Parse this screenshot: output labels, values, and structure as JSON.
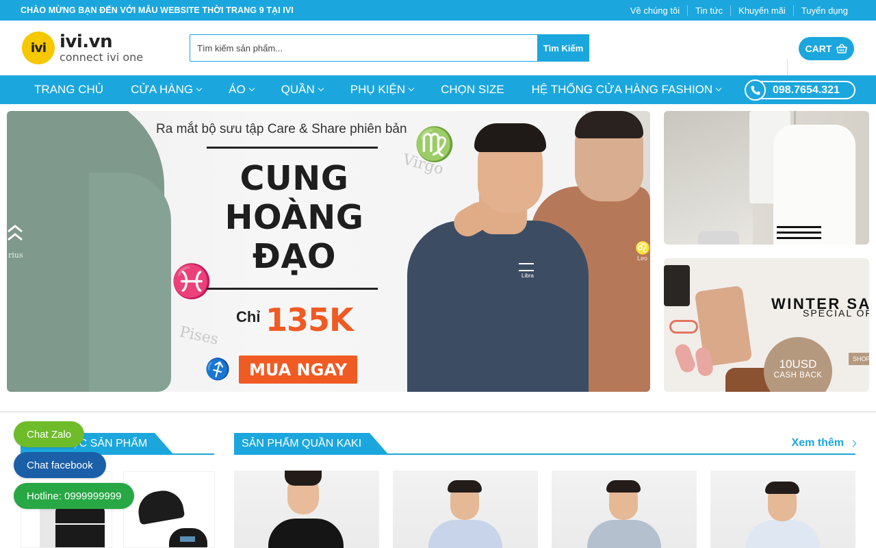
{
  "topbar": {
    "welcome": "CHÀO MỪNG BẠN ĐẾN VỚI MẪU WEBSITE THỜI TRANG 9 TẠI IVI",
    "links": [
      "Về chúng tôi",
      "Tin tức",
      "Khuyến mãi",
      "Tuyển dụng"
    ]
  },
  "header": {
    "logo_mark": "ivi",
    "logo_main": "ivi.vn",
    "logo_sub": "connect ivi one",
    "search_placeholder": "Tìm kiếm sản phẩm...",
    "search_button": "Tìm Kiếm",
    "cart_label": "CART"
  },
  "nav": {
    "items": [
      {
        "label": "TRANG CHỦ",
        "dropdown": false
      },
      {
        "label": "CỬA HÀNG",
        "dropdown": true
      },
      {
        "label": "ÁO",
        "dropdown": true
      },
      {
        "label": "QUẦN",
        "dropdown": true
      },
      {
        "label": "PHỤ KIỆN",
        "dropdown": true
      },
      {
        "label": "CHỌN SIZE",
        "dropdown": false
      },
      {
        "label": "HỆ THỐNG CỬA HÀNG FASHION",
        "dropdown": true
      }
    ],
    "hotline": "098.7654.321"
  },
  "banner": {
    "subtitle": "Ra mắt bộ sưu tập Care & Share phiên bản",
    "title_lines": [
      "CUNG",
      "HOÀNG",
      "ĐẠO"
    ],
    "price_label": "Chỉ",
    "price": "135K",
    "cta": "MUA NGAY",
    "zodiac_virgo": "Virgo",
    "zodiac_pisces": "Pises",
    "zodiac_aquarius": "rius",
    "tag_libra": "Libra",
    "tag_leo": "Leo"
  },
  "side_banner_2": {
    "title": "WINTER SA",
    "subtitle": "SPECIAL OF",
    "badge_amount": "10USD",
    "badge_text": "CASH BACK",
    "shop_tag": "SHOP"
  },
  "sections": {
    "categories_title": "DANH MỤC SẢN PHẨM",
    "kaki_title": "SẢN PHẨM QUẦN KAKI",
    "see_more": "Xem thêm"
  },
  "chat": {
    "zalo": "Chat Zalo",
    "facebook": "Chat facebook",
    "hotline": "Hotline: 0999999999"
  },
  "colors": {
    "primary": "#1ba7dd",
    "accent_orange": "#f05a23",
    "logo_yellow": "#f5c800",
    "zalo_green": "#6fbc2b",
    "facebook_blue": "#1a5fa8",
    "hotline_green": "#28a745"
  }
}
